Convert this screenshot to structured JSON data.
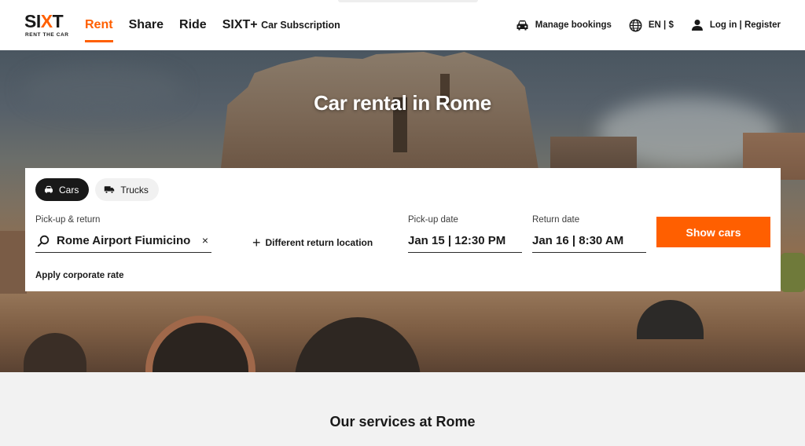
{
  "brand": {
    "logo_text": "SIXT",
    "tagline": "RENT THE CAR",
    "accent_color": "#ff5f00"
  },
  "nav": {
    "items": [
      {
        "label": "Rent",
        "active": true
      },
      {
        "label": "Share",
        "active": false
      },
      {
        "label": "Ride",
        "active": false
      }
    ],
    "subscription": {
      "prefix": "SIXT+",
      "label": "Car Subscription"
    }
  },
  "header_right": {
    "manage_bookings": {
      "label": "Manage bookings",
      "icon": "car-icon"
    },
    "language": {
      "label": "EN | $",
      "icon": "globe-icon"
    },
    "account": {
      "label": "Log in | Register",
      "icon": "user-icon"
    }
  },
  "hero": {
    "title": "Car rental in Rome"
  },
  "booking": {
    "vehicle_tabs": [
      {
        "label": "Cars",
        "icon": "car-icon",
        "selected": true
      },
      {
        "label": "Trucks",
        "icon": "truck-icon",
        "selected": false
      }
    ],
    "pickup_return": {
      "label": "Pick-up & return",
      "value": "Rome Airport Fiumicino",
      "icon": "search-icon",
      "clear": "×"
    },
    "different_return": {
      "label": "Different return location",
      "icon": "plus-icon"
    },
    "pickup_date": {
      "label": "Pick-up date",
      "value": "Jan 15 | 12:30 PM"
    },
    "return_date": {
      "label": "Return date",
      "value": "Jan 16 | 8:30 AM"
    },
    "submit_label": "Show cars",
    "corporate_label": "Apply corporate rate"
  },
  "services": {
    "title": "Our services at Rome"
  }
}
